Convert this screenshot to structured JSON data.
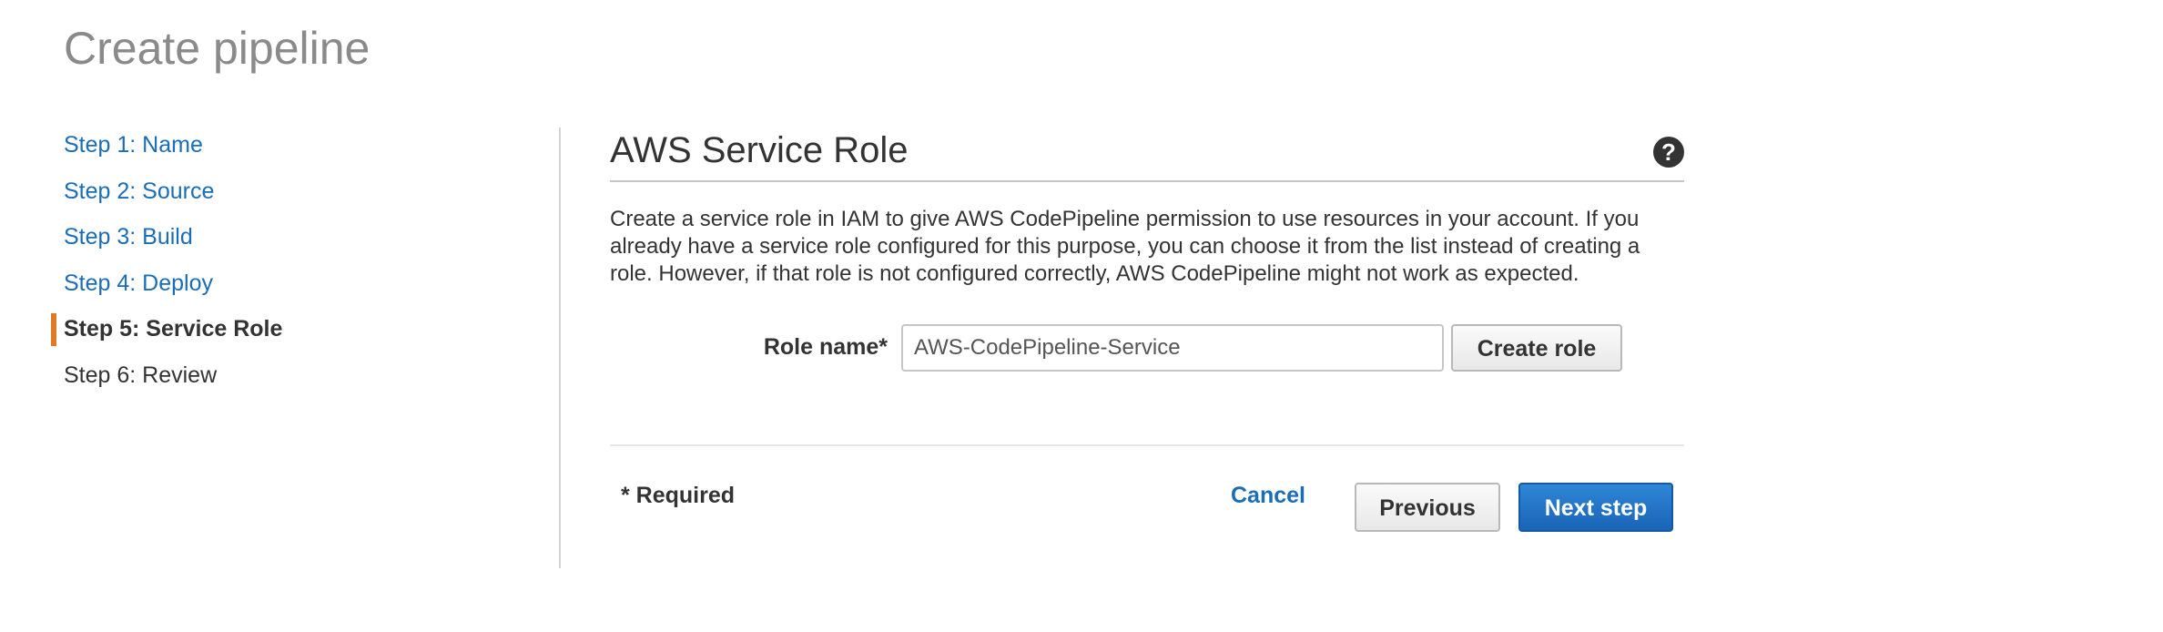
{
  "page": {
    "title": "Create pipeline"
  },
  "steps": [
    {
      "label": "Step 1: Name",
      "state": "link"
    },
    {
      "label": "Step 2: Source",
      "state": "link"
    },
    {
      "label": "Step 3: Build",
      "state": "link"
    },
    {
      "label": "Step 4: Deploy",
      "state": "link"
    },
    {
      "label": "Step 5: Service Role",
      "state": "active"
    },
    {
      "label": "Step 6: Review",
      "state": "upcoming"
    }
  ],
  "panel": {
    "title": "AWS Service Role",
    "help_icon": "question-circle-icon",
    "description": "Create a service role in IAM to give AWS CodePipeline permission to use resources in your account. If you already have a service role configured for this purpose, you can choose it from the list instead of creating a role. However, if that role is not configured correctly, AWS CodePipeline might not work as expected."
  },
  "form": {
    "role_label": "Role name*",
    "role_value": "AWS-CodePipeline-Service",
    "create_role_label": "Create role"
  },
  "footer": {
    "required_note": "* Required",
    "cancel_label": "Cancel",
    "previous_label": "Previous",
    "next_label": "Next step"
  },
  "colors": {
    "link": "#1a6db8",
    "active_marker": "#e07b24",
    "primary_button": "#1a64b8",
    "title_gray": "#8a8a8a"
  }
}
